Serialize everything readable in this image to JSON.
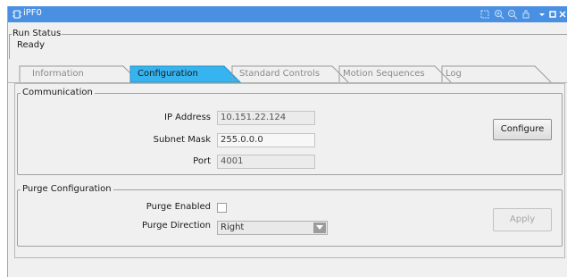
{
  "window": {
    "title": "iPF0"
  },
  "run_status": {
    "legend": "Run Status",
    "value": "Ready"
  },
  "tabs": [
    {
      "label": "Information",
      "active": false
    },
    {
      "label": "Configuration",
      "active": true
    },
    {
      "label": "Standard Controls",
      "active": false
    },
    {
      "label": "Motion Sequences",
      "active": false
    },
    {
      "label": "Log",
      "active": false
    }
  ],
  "communication": {
    "legend": "Communication",
    "ip_label": "IP Address",
    "ip_value": "10.151.22.124",
    "subnet_label": "Subnet Mask",
    "subnet_value": "255.0.0.0",
    "port_label": "Port",
    "port_value": "4001",
    "configure_label": "Configure"
  },
  "purge": {
    "legend": "Purge Configuration",
    "enabled_label": "Purge Enabled",
    "enabled": false,
    "direction_label": "Purge Direction",
    "direction_value": "Right",
    "apply_label": "Apply"
  },
  "colors": {
    "titlebar": "#4a90e2",
    "active_tab": "#36b4f0",
    "background": "#f0f0f0"
  }
}
